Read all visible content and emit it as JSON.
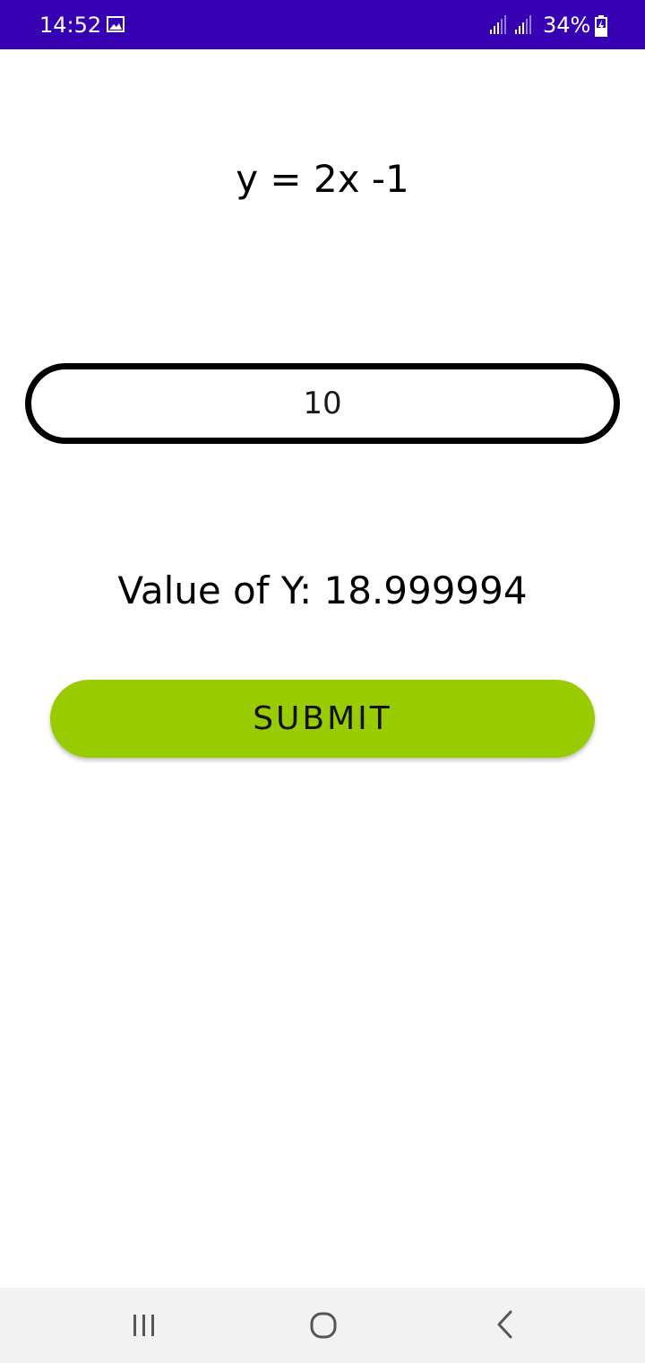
{
  "status_bar": {
    "time": "14:52",
    "battery": "34%",
    "icons": [
      "gallery-icon",
      "signal-icon",
      "signal-icon",
      "battery-charging-icon"
    ],
    "background_color": "#3700b3"
  },
  "main": {
    "equation": "y = 2x -1",
    "input": {
      "value": "10"
    },
    "result": "Value of Y: 18.999994",
    "submit_label": "SUBMIT",
    "submit_color": "#99cc00"
  },
  "nav_bar": {
    "icons": [
      "recents-icon",
      "home-icon",
      "back-icon"
    ]
  }
}
